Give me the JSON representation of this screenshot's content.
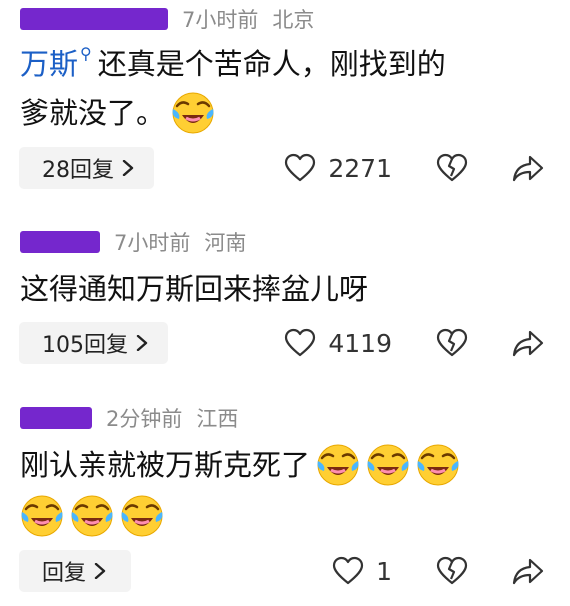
{
  "comments": [
    {
      "time": "7小时前",
      "location": "北京",
      "mention": "万斯",
      "text_line1": "还真是个苦命人，刚找到的",
      "text_line2": "爹就没了。",
      "emoji_line2": [
        "laugh-cry-emoji"
      ],
      "reply_label": "28回复",
      "likes": "2271"
    },
    {
      "time": "7小时前",
      "location": "河南",
      "text_line1": "这得通知万斯回来摔盆儿呀",
      "reply_label": "105回复",
      "likes": "4119"
    },
    {
      "time": "2分钟前",
      "location": "江西",
      "text_line1": "刚认亲就被万斯克死了",
      "emoji_line1": [
        "laugh-cry-emoji",
        "laugh-cry-emoji",
        "laugh-cry-emoji"
      ],
      "emoji_line2": [
        "laugh-cry-emoji",
        "laugh-cry-emoji",
        "laugh-cry-emoji"
      ],
      "reply_label": "回复",
      "likes": "1"
    }
  ],
  "colors": {
    "redaction": "#6a17c9",
    "mention": "#1b5fc6",
    "meta": "#8b8b8b",
    "reply_bg": "#f3f3f3"
  },
  "icons": [
    "heart-outline-icon",
    "broken-heart-icon",
    "share-arrow-icon",
    "chevron-right-icon",
    "search-icon",
    "laugh-cry-emoji"
  ]
}
